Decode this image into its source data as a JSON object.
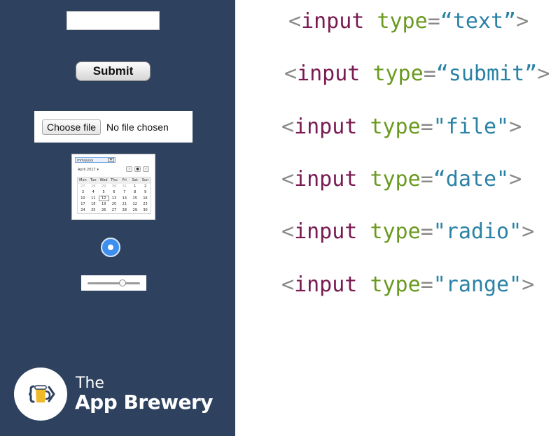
{
  "demo": {
    "submit_label": "Submit",
    "file": {
      "button_label": "Choose file",
      "status": "No file chosen"
    },
    "date": {
      "field_placeholder": "mm/yyyy",
      "month_label": "April 2017 ▾",
      "nav": [
        "‹",
        "●",
        "›"
      ],
      "weekdays": [
        "Mon",
        "Tue",
        "Wed",
        "Thu",
        "Fri",
        "Sat",
        "Sun"
      ],
      "weeks": [
        [
          "27",
          "28",
          "29",
          "30",
          "31",
          "1",
          "2"
        ],
        [
          "3",
          "4",
          "5",
          "6",
          "7",
          "8",
          "9"
        ],
        [
          "10",
          "11",
          "12",
          "13",
          "14",
          "15",
          "16"
        ],
        [
          "17",
          "18",
          "19",
          "20",
          "21",
          "22",
          "23"
        ],
        [
          "24",
          "25",
          "26",
          "27",
          "28",
          "29",
          "30"
        ]
      ]
    },
    "radio_checked": true,
    "range_value_fraction": 0.66
  },
  "brand": {
    "line1": "The",
    "line2": "App Brewery",
    "logo_icon": "beer-mug-code-icon"
  },
  "code_lines": [
    {
      "open": "<",
      "tag": "input",
      "attr": "type",
      "eq": "=",
      "value": "“text”",
      "close": ">"
    },
    {
      "open": "<",
      "tag": "input",
      "attr": "type",
      "eq": "=",
      "value": "“submit”",
      "close": ">"
    },
    {
      "open": "<",
      "tag": "input",
      "attr": "type",
      "eq": "=",
      "value": "\"file\"",
      "close": ">"
    },
    {
      "open": "<",
      "tag": "input",
      "attr": "type",
      "eq": "=",
      "value": "“date\"",
      "close": ">"
    },
    {
      "open": "<",
      "tag": "input",
      "attr": "type",
      "eq": "=",
      "value": "\"radio\"",
      "close": ">"
    },
    {
      "open": "<",
      "tag": "input",
      "attr": "type",
      "eq": "=",
      "value": "\"range\"",
      "close": ">"
    }
  ],
  "colors": {
    "panel": "#2e4260",
    "tag": "#7a1a52",
    "attr": "#6a9a1f",
    "value": "#2a82a5",
    "punct": "#8a8a8a",
    "radio": "#3d8fef"
  }
}
